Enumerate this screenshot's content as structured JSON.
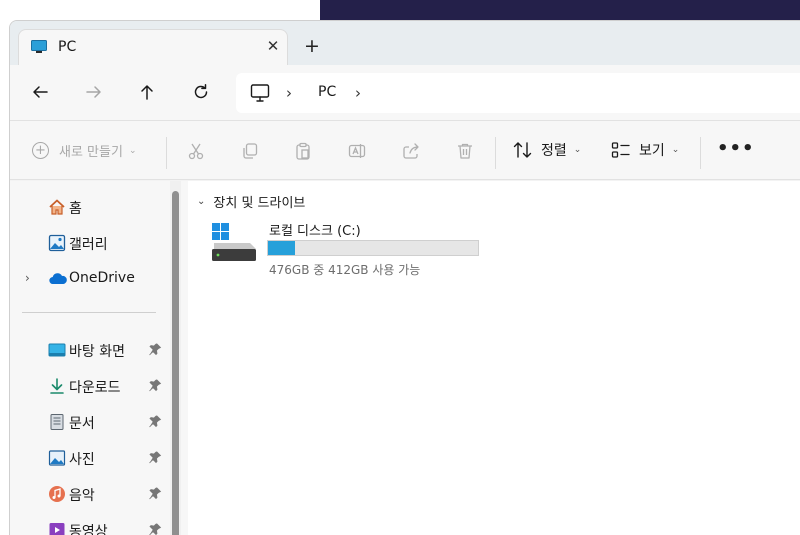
{
  "window": {
    "tab_title": "PC",
    "new_tab_label": "+"
  },
  "nav": {
    "address": {
      "segment": "PC"
    }
  },
  "commands": {
    "new_label": "새로 만들기",
    "sort_label": "정렬",
    "view_label": "보기"
  },
  "sidebar": {
    "items": [
      {
        "label": "홈",
        "icon": "home-icon"
      },
      {
        "label": "갤러리",
        "icon": "gallery-icon"
      },
      {
        "label": "OneDrive",
        "icon": "onedrive-icon"
      },
      {
        "label": "바탕 화면",
        "icon": "desktop-icon",
        "pinned": true
      },
      {
        "label": "다운로드",
        "icon": "download-icon",
        "pinned": true
      },
      {
        "label": "문서",
        "icon": "documents-icon",
        "pinned": true
      },
      {
        "label": "사진",
        "icon": "pictures-icon",
        "pinned": true
      },
      {
        "label": "음악",
        "icon": "music-icon",
        "pinned": true
      },
      {
        "label": "동영상",
        "icon": "videos-icon",
        "pinned": true
      }
    ]
  },
  "content": {
    "group_header": "장치 및 드라이브",
    "drives": [
      {
        "name": "로컬 디스크 (C:)",
        "free_text": "476GB 중 412GB 사용 가능",
        "used_fraction": 0.13
      }
    ]
  },
  "colors": {
    "accent": "#26a0da",
    "title_bg": "#24204a",
    "window_bg": "#f7f7f7"
  }
}
